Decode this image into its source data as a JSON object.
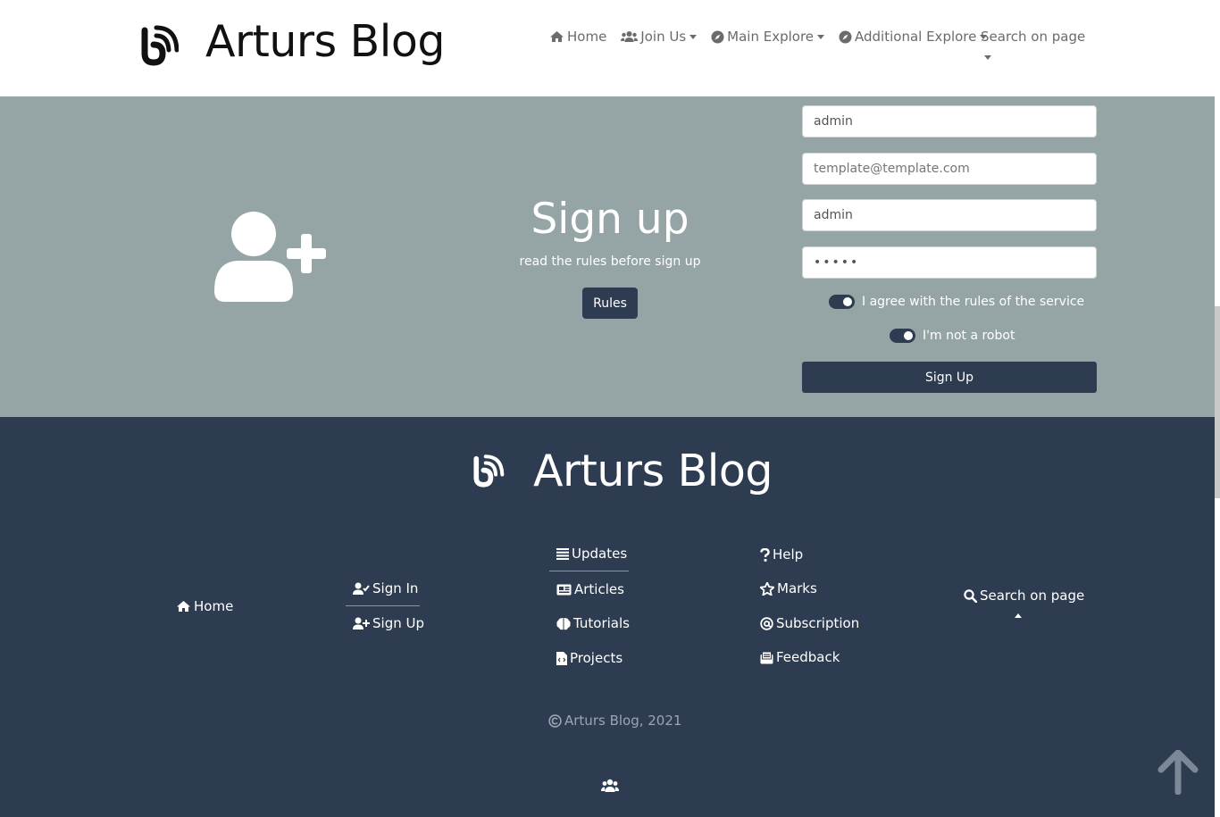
{
  "header": {
    "brand_title": "Arturs Blog",
    "nav": [
      {
        "label": "Home",
        "icon": "home-icon"
      },
      {
        "label": "Join Us",
        "icon": "users-icon"
      },
      {
        "label": "Main Explore",
        "icon": "compass-icon"
      },
      {
        "label": "Additional Explore",
        "icon": "compass-icon"
      }
    ],
    "search_label": "Search on page"
  },
  "signup": {
    "icon": "user-plus-icon",
    "title": "Sign up",
    "subtitle": "read the rules before sign up",
    "rules_label": "Rules",
    "fields": {
      "username_value": "admin",
      "email_placeholder": "template@template.com",
      "name_value": "admin",
      "password_value": "admin"
    },
    "agree_label": "I agree with the rules of the service",
    "robot_label": "I'm not a robot",
    "submit_label": "Sign Up"
  },
  "footer": {
    "brand_title": "Arturs Blog",
    "home_label": "Home",
    "signin_label": "Sign In",
    "signup_label": "Sign Up",
    "updates_label": "Updates",
    "articles_label": "Articles",
    "tutorials_label": "Tutorials",
    "projects_label": "Projects",
    "help_label": "Help",
    "marks_label": "Marks",
    "subscription_label": "Subscription",
    "feedback_label": "Feedback",
    "search_label": "Search on page",
    "copyright": "Arturs Blog, 2021"
  },
  "colors": {
    "header_bg": "#ffffff",
    "hero_bg": "#95a5a6",
    "footer_bg": "#2d3c50",
    "accent": "#2d3c50"
  }
}
